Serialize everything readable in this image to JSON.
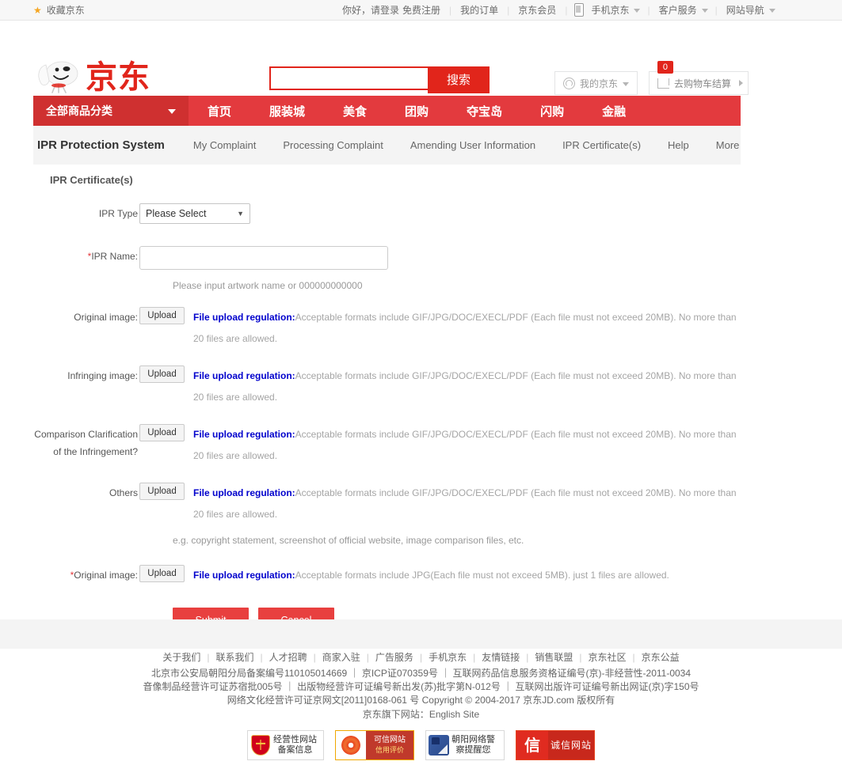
{
  "topbar": {
    "favorite": "收藏京东",
    "greeting": "你好，请登录",
    "register": "免费注册",
    "my_orders": "我的订单",
    "member": "京东会员",
    "mobile_jd": "手机京东",
    "customer_service": "客户服务",
    "site_nav": "网站导航"
  },
  "header": {
    "logo_text": "京东",
    "search_value": "",
    "search_placeholder": "",
    "search_button": "搜索",
    "my_jd": "我的京东",
    "cart": "去购物车结算",
    "cart_count": "0"
  },
  "nav": {
    "categories": "全部商品分类",
    "items": [
      {
        "label": "首页"
      },
      {
        "label": "服装城"
      },
      {
        "label": "美食"
      },
      {
        "label": "团购"
      },
      {
        "label": "夺宝岛"
      },
      {
        "label": "闪购"
      },
      {
        "label": "金融"
      }
    ]
  },
  "subnav": {
    "title": "IPR Protection System",
    "tabs": [
      {
        "label": "My Complaint"
      },
      {
        "label": "Processing Complaint"
      },
      {
        "label": "Amending User Information"
      },
      {
        "label": "IPR Certificate(s)"
      },
      {
        "label": "Help"
      },
      {
        "label": "More"
      }
    ]
  },
  "form": {
    "card_title": "IPR Certificate(s)",
    "ipr_type_label": "IPR Type",
    "ipr_type_value": "Please Select",
    "ipr_type_arrow": "▼",
    "ipr_name_required": "*",
    "ipr_name_label": "IPR Name:",
    "ipr_name_value": "",
    "ipr_name_hint": "Please input artwork name or 000000000000",
    "upload_button": "Upload",
    "regulation_label": "File upload regulation:",
    "regulation_20mb": "Acceptable formats include GIF/JPG/DOC/EXECL/PDF (Each file must not exceed 20MB). No more than 20 files are allowed.",
    "regulation_5mb": "Acceptable formats include JPG(Each file must not exceed 5MB). just 1 files are allowed.",
    "rows": [
      {
        "label": "Original image:"
      },
      {
        "label": "Infringing image:"
      },
      {
        "label": "Comparison Clarification of the Infringement?"
      },
      {
        "label": "Others"
      }
    ],
    "others_example": "e.g. copyright statement, screenshot of official website, image comparison files, etc.",
    "last_row_required": "*",
    "last_row_label": "Original image:",
    "submit": "Submit",
    "cancel": "Cancel"
  },
  "footer": {
    "links": [
      "关于我们",
      "联系我们",
      "人才招聘",
      "商家入驻",
      "广告服务",
      "手机京东",
      "友情链接",
      "销售联盟",
      "京东社区",
      "京东公益"
    ],
    "line1": "北京市公安局朝阳分局备案编号110105014669 ｜ 京ICP证070359号 ｜ 互联网药品信息服务资格证编号(京)-非经营性-2011-0034",
    "line2": "音像制品经营许可证苏宿批005号 ｜ 出版物经营许可证编号新出发(苏)批字第N-012号 ｜ 互联网出版许可证编号新出网证(京)字150号",
    "line3": "网络文化经营许可证京网文[2011]0168-061 号  Copyright © 2004-2017  京东JD.com 版权所有",
    "line4_prefix": "京东旗下网站：",
    "line4_link": "English Site",
    "badges": [
      {
        "line1": "经营性网站",
        "line2": "备案信息"
      },
      {
        "line1": "可信网站",
        "line2": "信用评价"
      },
      {
        "line1": "朝阳网络警",
        "line2": "察提醒您"
      },
      {
        "line1": "诚信网站",
        "line2": ""
      }
    ]
  },
  "colors": {
    "brand_red": "#e1251b",
    "nav_red": "#e33a3e",
    "nav_cat_red": "#cf3030",
    "button_red": "#e8403f",
    "regulation_blue": "#0000cc"
  }
}
